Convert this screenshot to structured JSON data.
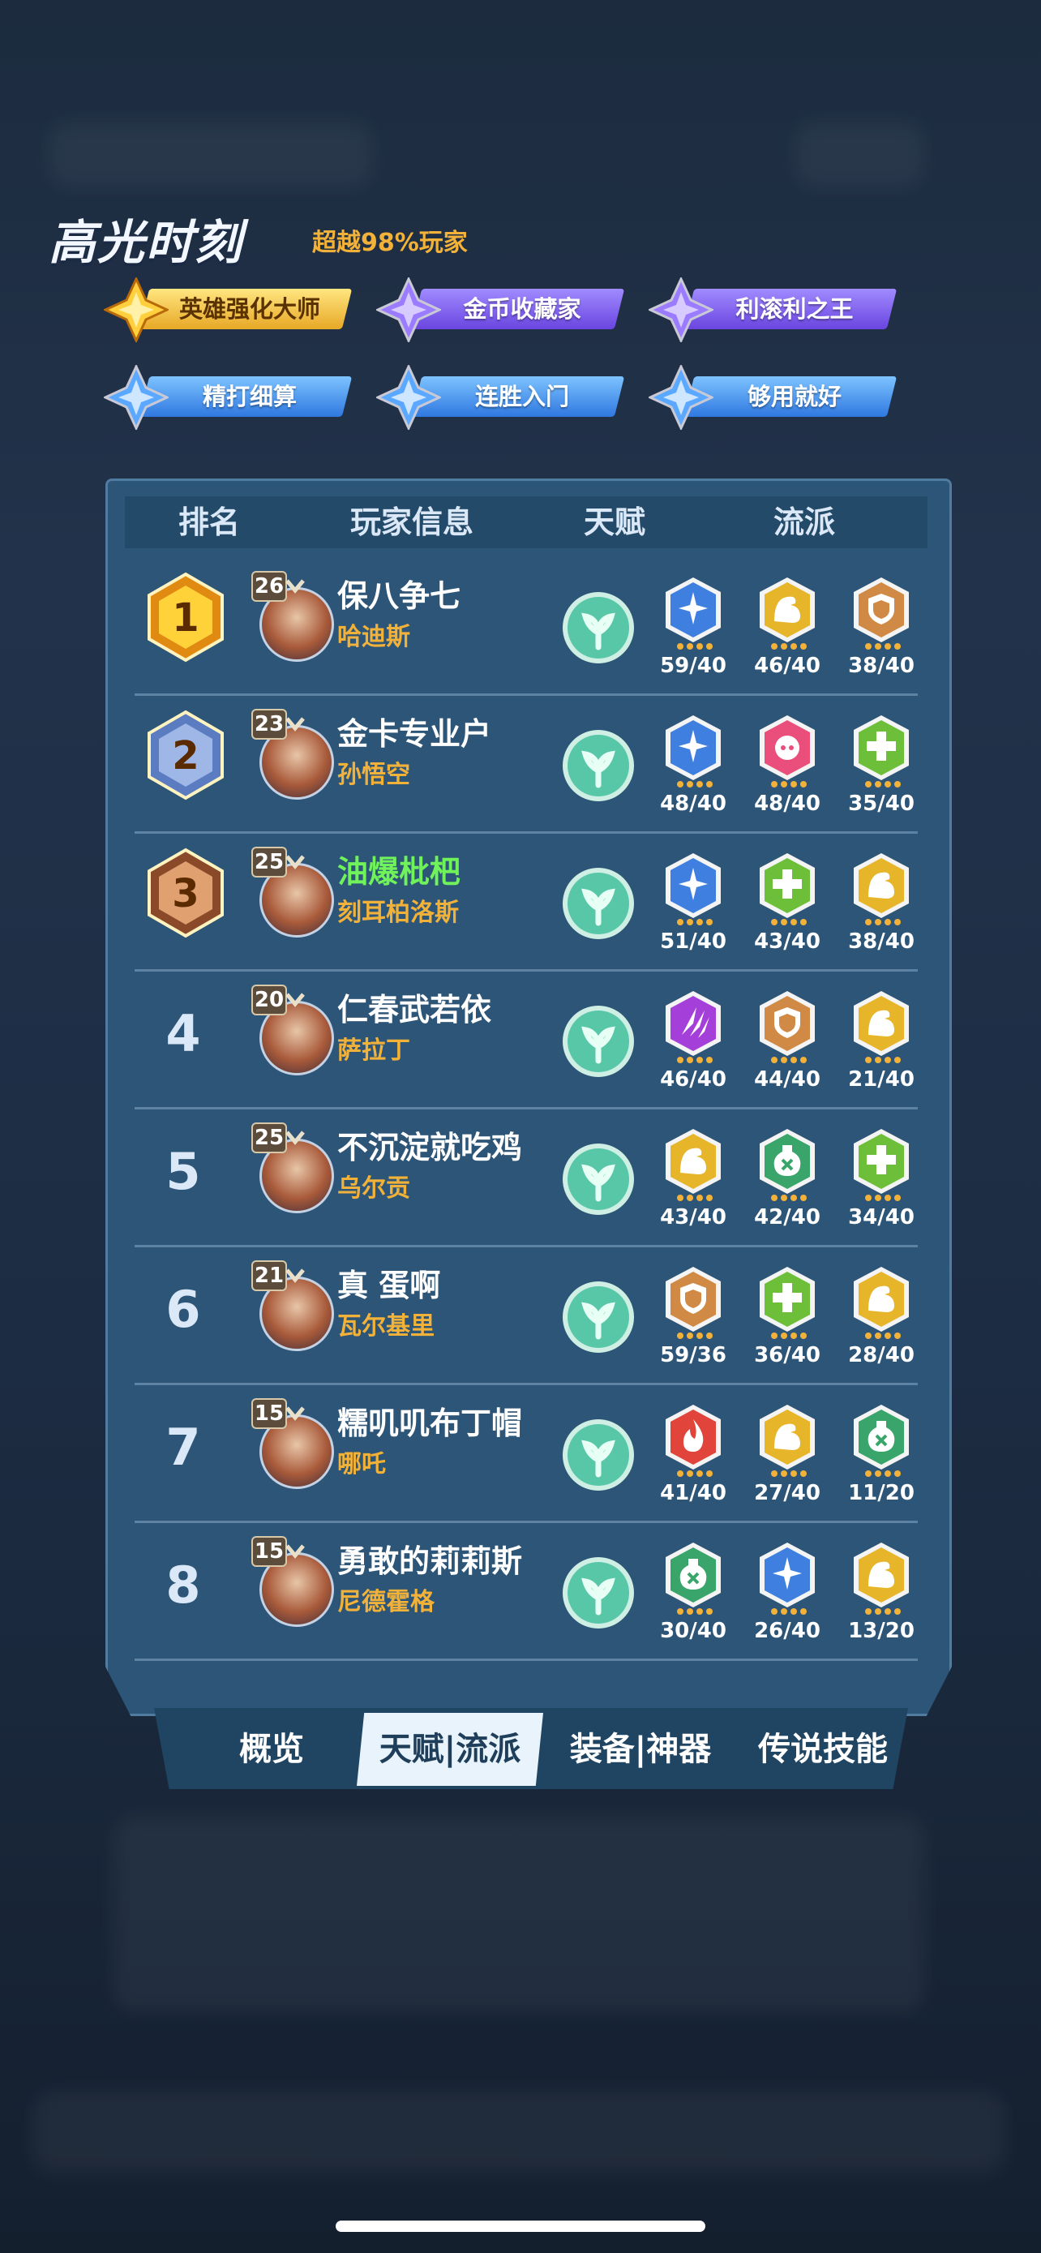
{
  "highlight": {
    "title": "高光时刻",
    "subtitle": "超越98%玩家",
    "badges": [
      {
        "label": "英雄强化大师",
        "color": "gold"
      },
      {
        "label": "金币收藏家",
        "color": "purple"
      },
      {
        "label": "利滚利之王",
        "color": "purple"
      },
      {
        "label": "精打细算",
        "color": "blue"
      },
      {
        "label": "连胜入门",
        "color": "blue"
      },
      {
        "label": "够用就好",
        "color": "blue"
      }
    ]
  },
  "table": {
    "headers": {
      "rank": "排名",
      "player": "玩家信息",
      "talent": "天赋",
      "build": "流派"
    },
    "rows": [
      {
        "rank": "1",
        "level": "26",
        "name": "保八争七",
        "hero": "哈迪斯",
        "builds": [
          {
            "icon": "spark-icon",
            "color": "blue",
            "value": "59/40"
          },
          {
            "icon": "arm-icon",
            "color": "gold",
            "value": "46/40"
          },
          {
            "icon": "shield-icon",
            "color": "bronze",
            "value": "38/40"
          }
        ]
      },
      {
        "rank": "2",
        "level": "23",
        "name": "金卡专业户",
        "hero": "孙悟空",
        "builds": [
          {
            "icon": "spark-icon",
            "color": "blue",
            "value": "48/40"
          },
          {
            "icon": "pig-icon",
            "color": "pink",
            "value": "48/40"
          },
          {
            "icon": "plus-icon",
            "color": "green",
            "value": "35/40"
          }
        ]
      },
      {
        "rank": "3",
        "level": "25",
        "name": "油爆枇杷",
        "hero": "刻耳柏洛斯",
        "builds": [
          {
            "icon": "spark-icon",
            "color": "blue",
            "value": "51/40"
          },
          {
            "icon": "plus-icon",
            "color": "green",
            "value": "43/40"
          },
          {
            "icon": "arm-icon",
            "color": "gold",
            "value": "38/40"
          }
        ]
      },
      {
        "rank": "4",
        "level": "20",
        "name": "仁春武若依",
        "hero": "萨拉丁",
        "builds": [
          {
            "icon": "claw-icon",
            "color": "purple",
            "value": "46/40"
          },
          {
            "icon": "shield-icon",
            "color": "bronze",
            "value": "44/40"
          },
          {
            "icon": "arm-icon",
            "color": "gold",
            "value": "21/40"
          }
        ]
      },
      {
        "rank": "5",
        "level": "25",
        "name": "不沉淀就吃鸡",
        "hero": "乌尔贡",
        "builds": [
          {
            "icon": "arm-icon",
            "color": "gold",
            "value": "43/40"
          },
          {
            "icon": "poison-icon",
            "color": "teal",
            "value": "42/40"
          },
          {
            "icon": "plus-icon",
            "color": "green",
            "value": "34/40"
          }
        ]
      },
      {
        "rank": "6",
        "level": "21",
        "name": "真 蛋啊",
        "hero": "瓦尔基里",
        "builds": [
          {
            "icon": "shield-icon",
            "color": "bronze",
            "value": "59/36"
          },
          {
            "icon": "plus-icon",
            "color": "green",
            "value": "36/40"
          },
          {
            "icon": "arm-icon",
            "color": "gold",
            "value": "28/40"
          }
        ]
      },
      {
        "rank": "7",
        "level": "15",
        "name": "糯叽叽布丁帽",
        "hero": "哪吒",
        "builds": [
          {
            "icon": "fire-icon",
            "color": "red",
            "value": "41/40"
          },
          {
            "icon": "arm-icon",
            "color": "gold",
            "value": "27/40"
          },
          {
            "icon": "poison-icon",
            "color": "teal",
            "value": "11/20"
          }
        ]
      },
      {
        "rank": "8",
        "level": "15",
        "name": "勇敢的莉莉斯",
        "hero": "尼德霍格",
        "builds": [
          {
            "icon": "poison-icon",
            "color": "teal",
            "value": "30/40"
          },
          {
            "icon": "spark-icon",
            "color": "blue",
            "value": "26/40"
          },
          {
            "icon": "arm-icon",
            "color": "gold",
            "value": "13/20"
          }
        ]
      }
    ]
  },
  "tabs": [
    {
      "label": "概览",
      "active": false
    },
    {
      "label": "天赋|流派",
      "active": true
    },
    {
      "label": "装备|神器",
      "active": false
    },
    {
      "label": "传说技能",
      "active": false
    }
  ],
  "colors": {
    "gold": "#e6b52a",
    "purple": "#a53fd9",
    "blue": "#3f7fe0",
    "bronze": "#d08a45",
    "green": "#6dbf3a",
    "pink": "#e94f7a",
    "teal": "#3aa56a",
    "red": "#e0443a",
    "talent": "#7fe0c0"
  }
}
